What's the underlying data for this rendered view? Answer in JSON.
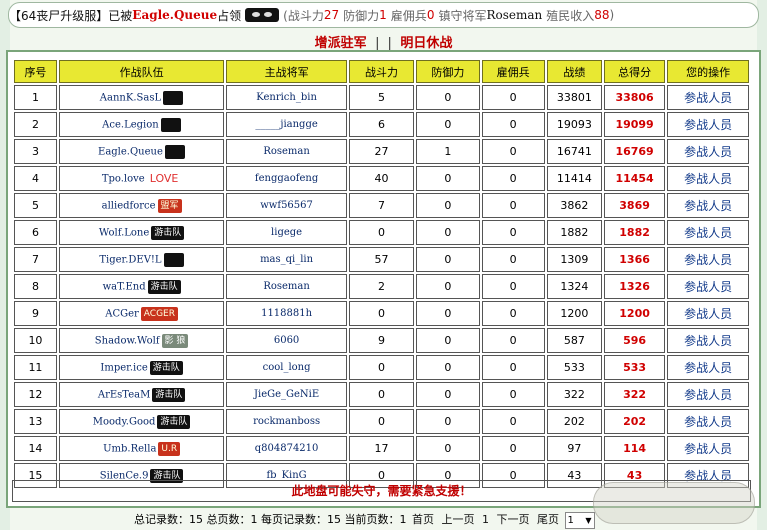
{
  "topbar": {
    "server": "【64丧尸升级服】",
    "taken_prefix": "已被",
    "owner": "Eagle.Queue",
    "taken_suffix": "占领",
    "stats_open": "(战斗力",
    "attack": "27",
    "defense_label": "防御力",
    "defense": "1",
    "merc_label": "雇佣兵",
    "merc": "0",
    "general_label": "镇守将军",
    "general": "Roseman",
    "income_label": "殖民收入",
    "income": "88",
    "close": ")"
  },
  "nav": {
    "reinforce": "增派驻军",
    "sep1": "|",
    "sep2": "|",
    "ceasefire": "明日休战"
  },
  "table": {
    "headers": [
      "序号",
      "作战队伍",
      "主战将军",
      "战斗力",
      "防御力",
      "雇佣兵",
      "战绩",
      "总得分",
      "您的操作"
    ],
    "rows": [
      {
        "idx": "1",
        "team": "AannK.SasL",
        "badge": "",
        "leader": "Kenrich_bin",
        "atk": "5",
        "def": "0",
        "merc": "0",
        "record": "33801",
        "score": "33806",
        "op": "参战人员"
      },
      {
        "idx": "2",
        "team": "Ace.Legion",
        "badge": "",
        "leader": "_____jiangge",
        "atk": "6",
        "def": "0",
        "merc": "0",
        "record": "19093",
        "score": "19099",
        "op": "参战人员"
      },
      {
        "idx": "3",
        "team": "Eagle.Queue",
        "badge": "",
        "leader": "Roseman",
        "atk": "27",
        "def": "1",
        "merc": "0",
        "record": "16741",
        "score": "16769",
        "op": "参战人员"
      },
      {
        "idx": "4",
        "team": "Tpo.love",
        "badge": "LOVE",
        "leader": "fenggaofeng",
        "atk": "40",
        "def": "0",
        "merc": "0",
        "record": "11414",
        "score": "11454",
        "op": "参战人员"
      },
      {
        "idx": "5",
        "team": "alliedforce",
        "badge": "盟军",
        "leader": "wwf56567",
        "atk": "7",
        "def": "0",
        "merc": "0",
        "record": "3862",
        "score": "3869",
        "op": "参战人员"
      },
      {
        "idx": "6",
        "team": "Wolf.Lone",
        "badge": "游击队",
        "leader": "ligege",
        "atk": "0",
        "def": "0",
        "merc": "0",
        "record": "1882",
        "score": "1882",
        "op": "参战人员"
      },
      {
        "idx": "7",
        "team": "Tiger.DEV!L",
        "badge": "",
        "leader": "mas_qi_lin",
        "atk": "57",
        "def": "0",
        "merc": "0",
        "record": "1309",
        "score": "1366",
        "op": "参战人员"
      },
      {
        "idx": "8",
        "team": "waT.End",
        "badge": "游击队",
        "leader": "Roseman",
        "atk": "2",
        "def": "0",
        "merc": "0",
        "record": "1324",
        "score": "1326",
        "op": "参战人员"
      },
      {
        "idx": "9",
        "team": "ACGer",
        "badge": "ACGER",
        "leader": "1118881h",
        "atk": "0",
        "def": "0",
        "merc": "0",
        "record": "1200",
        "score": "1200",
        "op": "参战人员"
      },
      {
        "idx": "10",
        "team": "Shadow.Wolf",
        "badge": "影 狼",
        "leader": "6060",
        "atk": "9",
        "def": "0",
        "merc": "0",
        "record": "587",
        "score": "596",
        "op": "参战人员"
      },
      {
        "idx": "11",
        "team": "Imper.ice",
        "badge": "游击队",
        "leader": "cool_long",
        "atk": "0",
        "def": "0",
        "merc": "0",
        "record": "533",
        "score": "533",
        "op": "参战人员"
      },
      {
        "idx": "12",
        "team": "ArEsTeaM",
        "badge": "游击队",
        "leader": "JieGe_GeNiE",
        "atk": "0",
        "def": "0",
        "merc": "0",
        "record": "322",
        "score": "322",
        "op": "参战人员"
      },
      {
        "idx": "13",
        "team": "Moody.Good",
        "badge": "游击队",
        "leader": "rockmanboss",
        "atk": "0",
        "def": "0",
        "merc": "0",
        "record": "202",
        "score": "202",
        "op": "参战人员"
      },
      {
        "idx": "14",
        "team": "Umb.Rella",
        "badge": "U.R",
        "leader": "q804874210",
        "atk": "17",
        "def": "0",
        "merc": "0",
        "record": "97",
        "score": "114",
        "op": "参战人员"
      },
      {
        "idx": "15",
        "team": "SilenCe.9",
        "badge": "游击队",
        "leader": "fb_KinG",
        "atk": "0",
        "def": "0",
        "merc": "0",
        "record": "43",
        "score": "43",
        "op": "参战人员"
      }
    ]
  },
  "notice": "此地盘可能失守，需要紧急支援！",
  "footer": {
    "total_records_label": "总记录数：",
    "total_records": "15",
    "total_pages_label": "总页数：",
    "total_pages": "1",
    "per_page_label": "每页记录数：",
    "per_page": "15",
    "current_page_label": "当前页数：",
    "current_page": "1",
    "first": "首页",
    "prev": "上一页",
    "page_num": "1",
    "next": "下一页",
    "last": "尾页",
    "select_value": "1"
  }
}
